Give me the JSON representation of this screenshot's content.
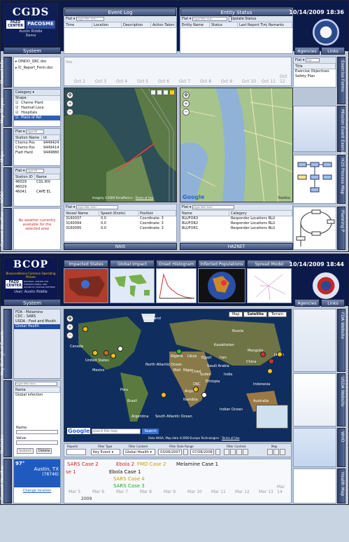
{
  "top": {
    "logo": {
      "brand": "CGDS",
      "sub1": "FAZD",
      "sub2": "CENTER",
      "sub3": "PACOSME"
    },
    "user": {
      "name": "Austin Riddle",
      "role": "Demo"
    },
    "clock": "10/14/2009  18:36",
    "system_label": "System",
    "event_log": {
      "title": "Event Log",
      "filter": "Flat",
      "placeholder": "<type filter text>",
      "columns": [
        "Time",
        "Location",
        "Description",
        "Action Taken"
      ]
    },
    "entity_status": {
      "title": "Entity Status",
      "filter": "Flat",
      "placeholder": "<type filter text>",
      "update_label": "Update Status",
      "columns": [
        "Entity Name",
        "Status",
        "Last Report Time",
        "Remarks"
      ]
    },
    "right_tabs": {
      "agencies": "Agencies",
      "links": "Links"
    },
    "left_tabs": [
      "Shared Info",
      "Map Shapes",
      "Ships",
      "NDBC",
      "Current Weather"
    ],
    "right_side_tabs": [
      "Exercise Forms",
      "Mission Event Exercise",
      "H2S Process Map",
      "Planning P"
    ],
    "shared_files": [
      "DINDO_QRC.doc",
      "IC_Report_Form.doc"
    ],
    "shapes": {
      "filter": "Category",
      "header": "Shape",
      "items": [
        "Chemo Plant",
        "Hazmat Loca",
        "Hospitals",
        "Place of Ref"
      ]
    },
    "ships": {
      "filter": "Flat",
      "placeholder": "<type filt",
      "columns": [
        "Station Name",
        "Id"
      ],
      "rows": [
        [
          "Chemo Pos",
          "9449424"
        ],
        [
          "Chemo Pos",
          "9449414"
        ],
        [
          "Flatt Hard",
          "9449880"
        ]
      ]
    },
    "ndbc": {
      "filter": "Flat",
      "placeholder": "<type filt",
      "columns": [
        "Station ID",
        "Name"
      ],
      "rows": [
        [
          "46029",
          "COL RIV"
        ],
        [
          "46029",
          ""
        ],
        [
          "46041",
          "CAPE EL"
        ]
      ]
    },
    "weather_note": "No weather currently available for the selected area",
    "timeline_ticks": [
      "Oct 2",
      "Oct 3",
      "Oct 4",
      "Oct 5",
      "Oct 6",
      "Oct 7",
      "Oct 8",
      "Oct 9",
      "Oct 10",
      "Oct 11",
      "Oct 12"
    ],
    "timeline_year": "Sep",
    "right_panel": {
      "filter": "Flat",
      "placeholder": "<typ",
      "title_col": "Title",
      "items": [
        "Exercise Objectives",
        "Safety Plan"
      ]
    },
    "map_attrib_left": "Imagery ©2009 TerraMetrics -",
    "map_attrib_left_link": "Terms of Use",
    "map_attrib_right": "TeleAtlas",
    "ais": {
      "filter": "Flat",
      "placeholder": "<type filter text>",
      "columns": [
        "Vessel Name",
        "Speed (Knots)",
        "Position"
      ],
      "rows": [
        [
          "3160037",
          "0.0",
          "Coordinate: 3"
        ],
        [
          "3160094",
          "0.0",
          "Coordinate: 3"
        ],
        [
          "3160095",
          "0.0",
          "Coordinate: 3"
        ]
      ],
      "label": "NAIS"
    },
    "hazmat": {
      "filter": "Flat",
      "placeholder": "<type filter text>",
      "columns": [
        "Name",
        "Category"
      ],
      "rows": [
        [
          "BLUFOR3",
          "Responder Locations BLU"
        ],
        [
          "BLUFOR2",
          "Responder Locations BLU"
        ],
        [
          "BLUFOR1",
          "Responder Locations BLU"
        ]
      ],
      "label": "HAZNET"
    }
  },
  "bottom": {
    "logo": {
      "brand": "BCOP",
      "sub1": "FAZD",
      "sub2": "CENTER",
      "tagline": "Biosurveillance Common Operating Picture",
      "center_name": "NATIONAL CENTER FOR FOREIGN ANIMAL AND ZOONOTIC DISEASE DEFENSE"
    },
    "user": "User: Austin Riddle",
    "clock": "10/14/2009  18:44",
    "system_label": "System",
    "tabs": [
      "Impacted States",
      "Global Impact",
      "Onset Histogram",
      "Infected Populations",
      "Spread Model"
    ],
    "right_tabs": {
      "agencies": "Agencies",
      "links": "Links"
    },
    "left_tabs": [
      "Key Biological Events",
      "Statistics",
      "Current Weather"
    ],
    "right_side_tabs": [
      "FDA Website",
      "USDA Website",
      "WHO",
      "Health Map"
    ],
    "events": [
      "FDA - Melamine",
      "CDC - SARS",
      "USDA - Foot and Mouth",
      "Global Health"
    ],
    "stats": {
      "placeholder": "<type filter text>",
      "col": "Name",
      "item": "Global infection",
      "name_label": "Name:",
      "value_label": "Value:",
      "submit": "Submit",
      "delete": "Delete"
    },
    "weather": {
      "temp": "97°",
      "city": "Austin, TX",
      "zip": "(78746)",
      "link": "Change location"
    },
    "map": {
      "types": [
        "Map",
        "Satellite",
        "Terrain"
      ],
      "search_placeholder": "search this map",
      "search_button": "Search",
      "attribution": "Data NASA, Map data ©2009 Europa Technologies -",
      "terms": "Terms of Use",
      "labels": [
        "Canada",
        "United States",
        "Brazil",
        "Russia",
        "China",
        "India",
        "Australia",
        "Indian Ocean",
        "South Atlantic Ocean",
        "North Atlantic Ocean",
        "Kazakhstan",
        "Mongolia",
        "Algeria",
        "Libya",
        "Egypt",
        "Saudi Arabia",
        "Iran",
        "Peru",
        "Argentina",
        "Greenland",
        "Mexico",
        "Mali",
        "Niger",
        "Chad",
        "Sudan",
        "Ethiopia",
        "DRC",
        "Angola",
        "Namibia",
        "Japan",
        "Indonesia"
      ]
    },
    "filters": {
      "reports_label": "Reports",
      "filter_type_label": "Filter Type",
      "filter_type": "Key Event",
      "filter_content_label": "Filter Content",
      "filter_content": "Global Health",
      "range_label": "Filter Date Range",
      "start": "03/06/2007",
      "end": "07/08/2008",
      "controls_label": "Filter Controls",
      "map_label": "Map"
    },
    "timeline": {
      "events": [
        "SARS Case 2",
        "Ebola 2",
        "FMD Case 2",
        "Melamine Case 1",
        "Ebola Case 1",
        "SARS Case 4",
        "SARS Case 3",
        "se 1"
      ],
      "ticks": [
        "Mar 5",
        "Mar 6",
        "Mar 7",
        "Mar 8",
        "Mar 9",
        "Mar 10",
        "Mar 11",
        "Mar 12",
        "Mar 13",
        "Mar 14"
      ],
      "year": "2009"
    }
  }
}
